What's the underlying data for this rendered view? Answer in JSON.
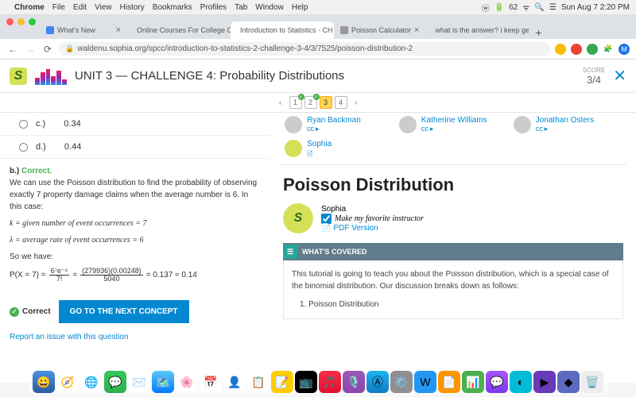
{
  "macbar": {
    "app": "Chrome",
    "menus": [
      "File",
      "Edit",
      "View",
      "History",
      "Bookmarks",
      "Profiles",
      "Tab",
      "Window",
      "Help"
    ],
    "battery": "62",
    "datetime": "Sun Aug 7  2:20 PM"
  },
  "tabs": [
    {
      "label": "What's New",
      "active": false
    },
    {
      "label": "Online Courses For College Cr",
      "active": false
    },
    {
      "label": "Introduction to Statistics - CH",
      "active": true
    },
    {
      "label": "Poisson Calculator",
      "active": false
    },
    {
      "label": "what is the answer? i keep ge",
      "active": false
    }
  ],
  "url": "waldenu.sophia.org/spcc/introduction-to-statistics-2-challenge-3-4/3/7525/poisson-distribution-2",
  "header": {
    "title": "UNIT 3 — CHALLENGE 4: Probability Distributions",
    "score_label": "SCORE",
    "score_value": "3/4"
  },
  "pager": {
    "items": [
      "1",
      "2",
      "3",
      "4"
    ],
    "active_index": 2,
    "checked": [
      0,
      1
    ]
  },
  "answers": {
    "c_label": "c.)",
    "c_value": "0.34",
    "d_label": "d.)",
    "d_value": "0.44"
  },
  "explain": {
    "prefix": "b.)",
    "badge": "Correct.",
    "p1": "We can use the Poisson distribution to find the probability of observing exactly 7 property damage claims when the average number is 6. In this case:",
    "k_line": "k = given number of event occurrences = 7",
    "l_line": "λ = average rate of event occurrences = 6",
    "so": "So we have:",
    "px": "P(X = 7) =",
    "f1_num": "6⁷e⁻⁶",
    "f1_den": "7!",
    "eq1": "=",
    "f2_num": "(279936)(0.00248)",
    "f2_den": "5040",
    "result": "= 0.137 ≈ 0.14"
  },
  "correct_label": "Correct",
  "next_button": "GO TO THE NEXT CONCEPT",
  "report_link": "Report an issue with this question",
  "instructors": [
    {
      "name": "Ryan Backman"
    },
    {
      "name": "Katherine Williams"
    },
    {
      "name": "Jonathan Osters"
    },
    {
      "name": "Sophia",
      "sophia": true
    }
  ],
  "article": {
    "title": "Poisson Distribution",
    "author": "Sophia",
    "fav_label": "Make my favorite instructor",
    "pdf_label": "PDF Version",
    "covered": "WHAT'S COVERED",
    "intro": "This tutorial is going to teach you about the Poisson distribution, which is a special case of the binomial distribution. Our discussion breaks down as follows:",
    "item1": "1. Poisson Distribution"
  }
}
